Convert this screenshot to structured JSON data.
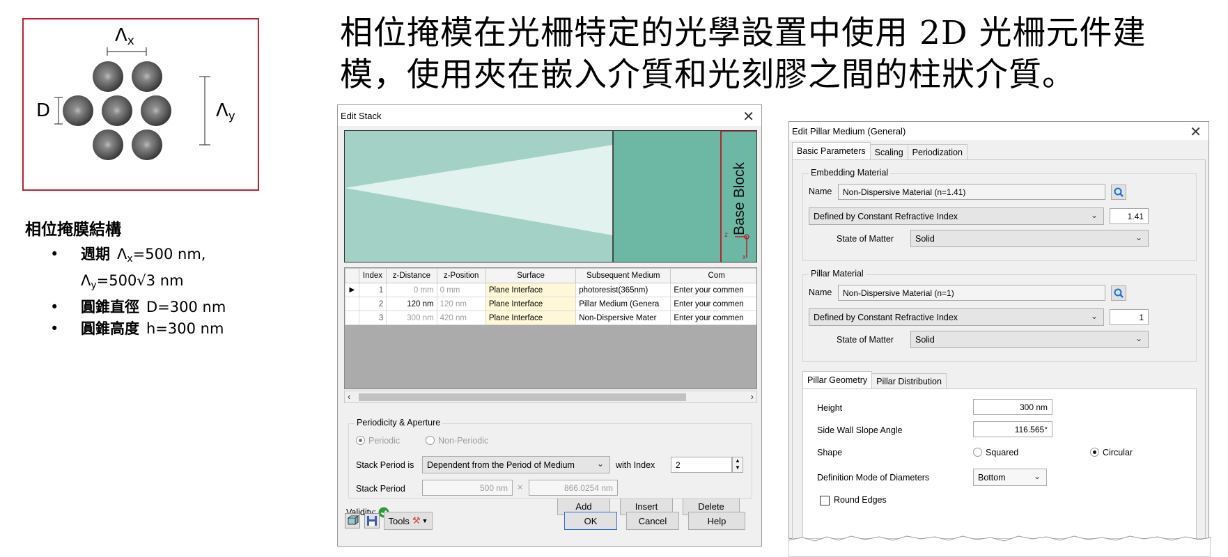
{
  "slide": {
    "heading_line1": "相位掩模在光柵特定的光學設置中使用 2D 光柵元件建",
    "heading_line2": "模，使用夾在嵌入介質和光刻膠之間的柱狀介質。",
    "diagram": {
      "label_lx": "Λ",
      "label_lx_sub": "x",
      "label_ly": "Λ",
      "label_ly_sub": "y",
      "label_d": "D",
      "border_color": "#c0202c"
    },
    "structure": {
      "title": "相位掩膜結構",
      "bullet_dot": "•",
      "period_key": "週期",
      "period_lx": "Λ",
      "period_lx_sub": "x",
      "period_lx_val": "=500 nm,",
      "period_ly": "Λ",
      "period_ly_sub": "y",
      "period_ly_val": "=500√3 nm",
      "diameter_key": "圓錐直徑",
      "diameter_val": "D=300 nm",
      "height_key": "圓錐高度",
      "height_val": "h=300 nm"
    }
  },
  "edit_stack": {
    "title": "Edit Stack",
    "close_glyph": "✕",
    "base_block_label": "Base Block",
    "axis_z": "z",
    "axis_x": "x",
    "columns": [
      "",
      "Index",
      "z-Distance",
      "z-Position",
      "Surface",
      "Subsequent Medium",
      "Com"
    ],
    "rows": [
      {
        "marker": "▶",
        "index": "1",
        "zdist": "0 mm",
        "zpos": "0 mm",
        "surface": "Plane Interface",
        "medium": "photoresist(365nm)",
        "comment": "Enter your commen"
      },
      {
        "marker": "",
        "index": "2",
        "zdist": "120 nm",
        "zpos": "120 nm",
        "surface": "Plane Interface",
        "medium": "Pillar Medium (Genera",
        "comment": "Enter your commen"
      },
      {
        "marker": "",
        "index": "3",
        "zdist": "300 nm",
        "zpos": "420 nm",
        "surface": "Plane Interface",
        "medium": "Non-Dispersive Mater",
        "comment": "Enter your commen"
      }
    ],
    "validity_label": "Validity:",
    "add_label": "Add",
    "insert_label": "Insert",
    "delete_label": "Delete",
    "periodicity_group": "Periodicity & Aperture",
    "periodic_label": "Periodic",
    "non_periodic_label": "Non-Periodic",
    "stack_period_is_label": "Stack Period is",
    "stack_period_mode": "Dependent from the Period of Medium",
    "with_index_label": "with Index",
    "with_index_value": "2",
    "stack_period_label": "Stack Period",
    "period_x": "500 nm",
    "times": "×",
    "period_y": "866.0254 nm",
    "tools_label": "Tools",
    "ok_label": "OK",
    "cancel_label": "Cancel",
    "help_label": "Help",
    "colors": {
      "preview_light": "#a3d1c6",
      "preview_dark": "#6db8a5",
      "wedge": "#e2f2ee",
      "surface_cell": "#fff8d8"
    }
  },
  "pillar_dialog": {
    "title": "Edit Pillar Medium (General)",
    "close_glyph": "✕",
    "tabs": [
      "Basic Parameters",
      "Scaling",
      "Periodization"
    ],
    "embedding_group": "Embedding Material",
    "name_label": "Name",
    "embedding_name": "Non-Dispersive Material (n=1.41)",
    "embedding_def": "Defined by Constant Refractive Index",
    "embedding_index": "1.41",
    "state_label": "State of Matter",
    "embedding_state": "Solid",
    "pillar_group": "Pillar Material",
    "pillar_name": "Non-Dispersive Material (n=1)",
    "pillar_def": "Defined by Constant Refractive Index",
    "pillar_index": "1",
    "pillar_state": "Solid",
    "sub_tabs": [
      "Pillar Geometry",
      "Pillar Distribution"
    ],
    "height_label": "Height",
    "height_value": "300 nm",
    "slope_label": "Side Wall Slope Angle",
    "slope_value": "116.565°",
    "shape_label": "Shape",
    "shape_squared": "Squared",
    "shape_circular": "Circular",
    "diam_mode_label": "Definition Mode of Diameters",
    "diam_mode_value": "Bottom",
    "round_edges_label": "Round Edges"
  }
}
